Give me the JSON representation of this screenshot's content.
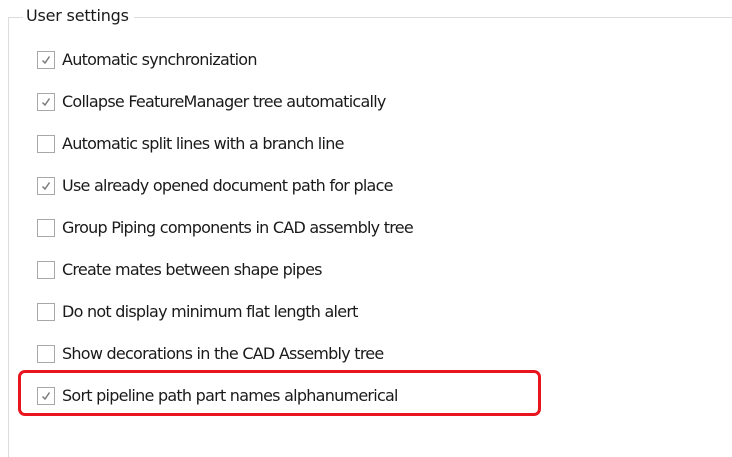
{
  "group": {
    "title": "User settings"
  },
  "options": [
    {
      "label": "Automatic synchronization",
      "checked": true
    },
    {
      "label": "Collapse FeatureManager tree automatically",
      "checked": true
    },
    {
      "label": "Automatic split lines with a branch line",
      "checked": false
    },
    {
      "label": "Use already opened document path for place",
      "checked": true
    },
    {
      "label": "Group Piping components in CAD assembly tree",
      "checked": false
    },
    {
      "label": "Create mates between shape pipes",
      "checked": false
    },
    {
      "label": "Do not display minimum flat length alert",
      "checked": false
    },
    {
      "label": "Show decorations in the CAD Assembly tree",
      "checked": false
    },
    {
      "label": "Sort pipeline path part names alphanumerical",
      "checked": true
    }
  ],
  "highlight_color": "#e8141e",
  "icons": {
    "checked": "checkmark-icon"
  }
}
